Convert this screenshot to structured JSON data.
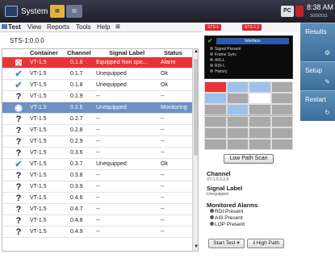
{
  "system": {
    "label": "System",
    "time": "8:38 AM",
    "date": "3/29/2011",
    "pc_label": "PC"
  },
  "menu": {
    "test": "Test",
    "view": "View",
    "reports": "Reports",
    "tools": "Tools",
    "help": "Help"
  },
  "alarms_bar": [
    "STS-1",
    "STS-1.2"
  ],
  "sts_label": "STS-1:0.0.0",
  "table": {
    "headers": {
      "container": "Container",
      "channel": "Channel",
      "signal_label": "Signal Label",
      "status": "Status"
    },
    "rows": [
      {
        "icon": "error-icon",
        "container": "VT-1.5",
        "channel": "0.1.6",
        "signal": "Equipped Non spe...",
        "status": "Alarm",
        "style": "red"
      },
      {
        "icon": "check-icon",
        "container": "VT-1.5",
        "channel": "0.1.7",
        "signal": "Unequipped",
        "status": "Ok",
        "style": ""
      },
      {
        "icon": "check-icon",
        "container": "VT-1.5",
        "channel": "0.1.8",
        "signal": "Unequipped",
        "status": "Ok",
        "style": ""
      },
      {
        "icon": "question-icon",
        "container": "VT-1.5",
        "channel": "0.1.9",
        "signal": "--",
        "status": "--",
        "style": ""
      },
      {
        "icon": "monitor-icon",
        "container": "VT-1.5",
        "channel": "0.2.6",
        "signal": "Unequipped",
        "status": "Monitoring",
        "style": "sel"
      },
      {
        "icon": "question-icon",
        "container": "VT-1.5",
        "channel": "0.2.7",
        "signal": "--",
        "status": "--",
        "style": ""
      },
      {
        "icon": "question-icon",
        "container": "VT-1.5",
        "channel": "0.2.8",
        "signal": "--",
        "status": "--",
        "style": ""
      },
      {
        "icon": "question-icon",
        "container": "VT-1.5",
        "channel": "0.2.9",
        "signal": "--",
        "status": "--",
        "style": ""
      },
      {
        "icon": "question-icon",
        "container": "VT-1.5",
        "channel": "0.3.6",
        "signal": "--",
        "status": "--",
        "style": ""
      },
      {
        "icon": "check-icon",
        "container": "VT-1.5",
        "channel": "0.3.7",
        "signal": "Unequipped",
        "status": "Ok",
        "style": ""
      },
      {
        "icon": "question-icon",
        "container": "VT-1.5",
        "channel": "0.3.8",
        "signal": "--",
        "status": "--",
        "style": ""
      },
      {
        "icon": "question-icon",
        "container": "VT-1.5",
        "channel": "0.3.9",
        "signal": "--",
        "status": "--",
        "style": ""
      },
      {
        "icon": "question-icon",
        "container": "VT-1.5",
        "channel": "0.4.6",
        "signal": "--",
        "status": "--",
        "style": ""
      },
      {
        "icon": "question-icon",
        "container": "VT-1.5",
        "channel": "0.4.7",
        "signal": "--",
        "status": "--",
        "style": ""
      },
      {
        "icon": "question-icon",
        "container": "VT-1.5",
        "channel": "0.4.8",
        "signal": "--",
        "status": "--",
        "style": ""
      },
      {
        "icon": "question-icon",
        "container": "VT-1.5",
        "channel": "0.4.9",
        "signal": "--",
        "status": "--",
        "style": ""
      }
    ]
  },
  "interface_panel": {
    "title": "Interface",
    "leds": [
      "Signal Present",
      "Frame Sync",
      "AIS-L",
      "RDI-L",
      "History"
    ]
  },
  "low_path_scan_button": "Low Path Scan",
  "details": {
    "channel_heading": "Channel",
    "channel_value": "VT-1.5 0.2.6",
    "signal_label_heading": "Signal Label",
    "signal_label_value": "Unequipped",
    "monitored_alarms_heading": "Monitored Alarms",
    "alarms": [
      "RDI Present",
      "AIS Present",
      "LOP Present"
    ]
  },
  "start_test_button": "Start Test",
  "high_path_button": "High Path",
  "side_buttons": [
    "Results",
    "Setup",
    "Restart"
  ],
  "colors": {
    "alarm_red": "#e8333a",
    "selected_blue": "#6e90c4",
    "side_blue": "#4a7dab"
  }
}
